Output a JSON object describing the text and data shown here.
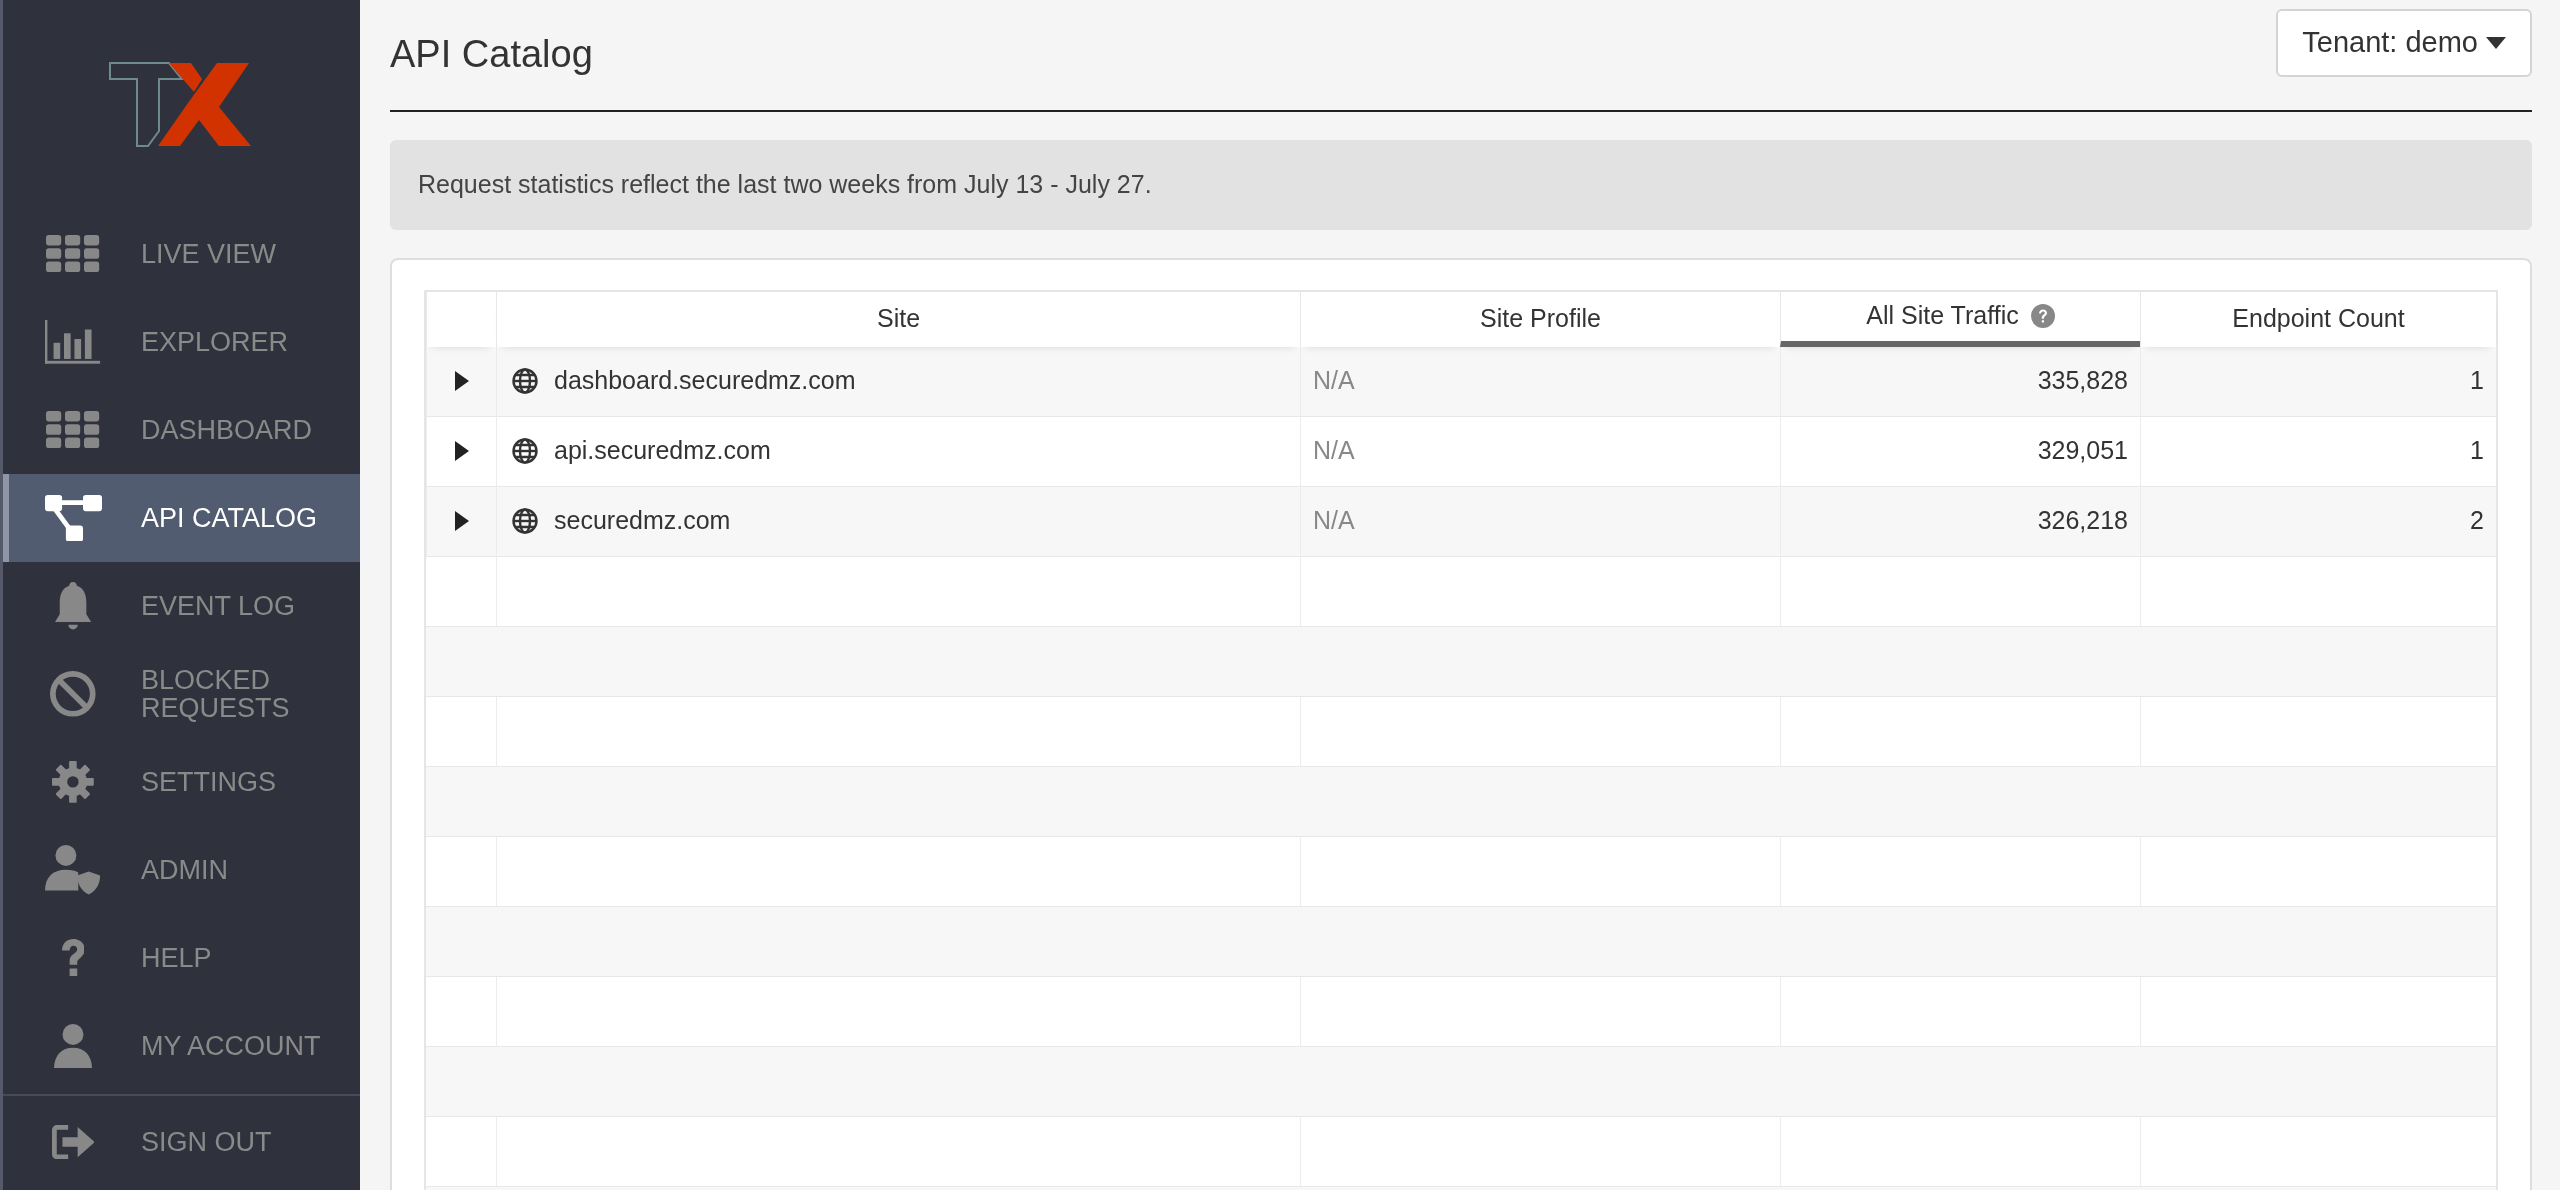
{
  "sidebar": {
    "items": [
      {
        "label": "LIVE VIEW",
        "selected": false
      },
      {
        "label": "EXPLORER",
        "selected": false
      },
      {
        "label": "DASHBOARD",
        "selected": false
      },
      {
        "label": "API CATALOG",
        "selected": true
      },
      {
        "label": "EVENT LOG",
        "selected": false
      },
      {
        "label": "BLOCKED REQUESTS",
        "selected": false
      },
      {
        "label": "SETTINGS",
        "selected": false
      },
      {
        "label": "ADMIN",
        "selected": false
      },
      {
        "label": "HELP",
        "selected": false
      },
      {
        "label": "MY ACCOUNT",
        "selected": false
      }
    ],
    "footer_items": [
      {
        "label": "SIGN OUT",
        "selected": false
      }
    ]
  },
  "page": {
    "title": "API Catalog",
    "tenant_button": "Tenant: demo"
  },
  "notice": "Request statistics reflect the last two weeks from July 13 - July 27.",
  "table": {
    "columns": [
      {
        "label": "Site",
        "sorted": false,
        "help": false
      },
      {
        "label": "Site Profile",
        "sorted": false,
        "help": false
      },
      {
        "label": "All Site Traffic",
        "sorted": true,
        "help": true
      },
      {
        "label": "Endpoint Count",
        "sorted": false,
        "help": false
      }
    ],
    "rows": [
      {
        "expanded": false,
        "cells": [
          "dashboard.securedmz.com",
          "N/A",
          "335,828",
          "1"
        ]
      },
      {
        "expanded": false,
        "cells": [
          "api.securedmz.com",
          "N/A",
          "329,051",
          "1"
        ]
      },
      {
        "expanded": false,
        "cells": [
          "securedmz.com",
          "N/A",
          "326,218",
          "2"
        ]
      }
    ]
  }
}
